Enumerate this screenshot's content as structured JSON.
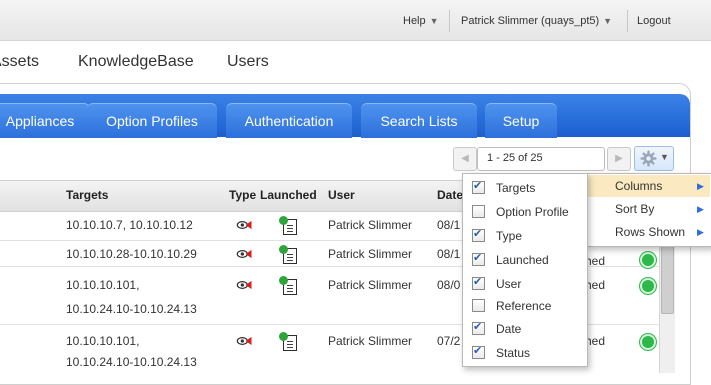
{
  "topbar": {
    "help": "Help",
    "user": "Patrick Slimmer (quays_pt5)",
    "logout": "Logout"
  },
  "nav": {
    "items": [
      "Assets",
      "KnowledgeBase",
      "Users"
    ]
  },
  "tabs": {
    "items": [
      "Appliances",
      "Option Profiles",
      "Authentication",
      "Search Lists",
      "Setup"
    ]
  },
  "pager": {
    "range": "1 - 25 of 25"
  },
  "table": {
    "headers": {
      "targets": "Targets",
      "type": "Type",
      "launched": "Launched",
      "user": "User",
      "date": "Date"
    },
    "rows": [
      {
        "targets_1": "10.10.10.7, 10.10.10.12",
        "targets_2": "",
        "user": "Patrick Slimmer",
        "date": "08/1",
        "state": ""
      },
      {
        "targets_1": "10.10.10.28-10.10.10.29",
        "targets_2": "",
        "user": "Patrick Slimmer",
        "date": "08/1",
        "state": "hed"
      },
      {
        "targets_1": "10.10.10.101,",
        "targets_2": "10.10.24.10-10.10.24.13",
        "user": "Patrick Slimmer",
        "date": "08/0",
        "state": "hed"
      },
      {
        "targets_1": "10.10.10.101,",
        "targets_2": "10.10.24.10-10.10.24.13",
        "user": "Patrick Slimmer",
        "date": "07/2",
        "state": "hed"
      }
    ]
  },
  "columns_menu": {
    "items": [
      {
        "label": "Targets",
        "checked": true
      },
      {
        "label": "Option Profile",
        "checked": false
      },
      {
        "label": "Type",
        "checked": true
      },
      {
        "label": "Launched",
        "checked": true
      },
      {
        "label": "User",
        "checked": true
      },
      {
        "label": "Reference",
        "checked": false
      },
      {
        "label": "Date",
        "checked": true
      },
      {
        "label": "Status",
        "checked": true
      }
    ]
  },
  "options_menu": {
    "items": [
      "Columns",
      "Sort By",
      "Rows Shown"
    ]
  },
  "colors": {
    "tab_blue": "#2d6fdb",
    "status_green": "#2fb84a",
    "menu_highlight": "#fbe9c2"
  }
}
